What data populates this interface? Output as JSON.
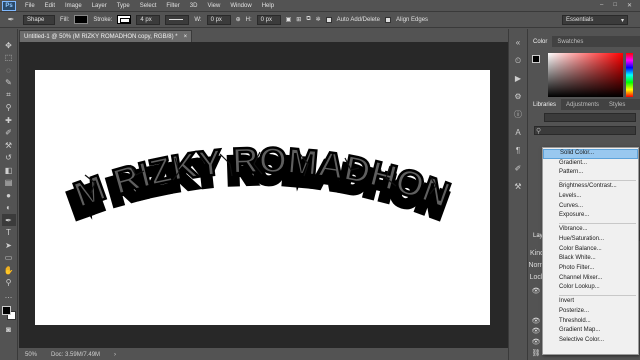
{
  "menubar": {
    "logo": "Ps",
    "items": [
      "File",
      "Edit",
      "Image",
      "Layer",
      "Type",
      "Select",
      "Filter",
      "3D",
      "View",
      "Window",
      "Help"
    ],
    "controls": [
      "–",
      "□",
      "✕"
    ]
  },
  "options_bar": {
    "tool_mode": "Shape",
    "fill_label": "Fill:",
    "stroke_label": "Stroke:",
    "stroke_width": "4 px",
    "w_label": "W:",
    "w_value": "0 px",
    "h_label": "H:",
    "h_value": "0 px",
    "auto_add_delete": "Auto Add/Delete",
    "align_edges": "Align Edges",
    "workspace": "Essentials"
  },
  "document": {
    "tab_title": "Untitled-1 @ 50% (M RIZKY ROMADHON copy, RGB/8) *",
    "tab_close": "×",
    "artwork_text": "M RIZKY ROMADHON"
  },
  "status": {
    "zoom": "50%",
    "doc_info": "Doc: 3.59M/7.49M"
  },
  "panels": {
    "color_tabs": [
      "Color",
      "Swatches"
    ],
    "library_tabs": [
      "Libraries",
      "Adjustments",
      "Styles"
    ],
    "layers_tab": "Laye",
    "layers_kind": "Kind",
    "layers_mode": "Norm",
    "layers_lock": "Lock"
  },
  "adjustment_menu": {
    "groups": [
      [
        "Solid Color...",
        "Gradient...",
        "Pattern..."
      ],
      [
        "Brightness/Contrast...",
        "Levels...",
        "Curves...",
        "Exposure..."
      ],
      [
        "Vibrance...",
        "Hue/Saturation...",
        "Color Balance...",
        "Black  White...",
        "Photo Filter...",
        "Channel Mixer...",
        "Color Lookup..."
      ],
      [
        "Invert",
        "Posterize...",
        "Threshold...",
        "Gradient Map...",
        "Selective Color..."
      ]
    ],
    "highlighted": "Solid Color..."
  },
  "colors": {
    "accent": "#99c8ef",
    "ui_bg": "#535353",
    "canvas_bg": "#282828",
    "text_fill": "#5f5f5f"
  },
  "tools": [
    "move-icon",
    "marquee-icon",
    "lasso-icon",
    "quick-select-icon",
    "crop-icon",
    "eyedropper-icon",
    "healing-icon",
    "brush-icon",
    "clone-stamp-icon",
    "history-brush-icon",
    "eraser-icon",
    "gradient-icon",
    "blur-icon",
    "dodge-icon",
    "pen-icon",
    "type-icon",
    "path-select-icon",
    "rectangle-icon",
    "hand-icon",
    "zoom-icon"
  ]
}
